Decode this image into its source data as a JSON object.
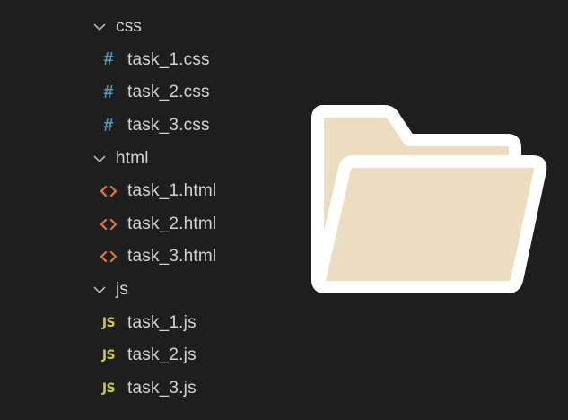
{
  "explorer": {
    "folders": [
      {
        "name": "css",
        "expanded": true,
        "icon": "chevron-down-icon",
        "files": [
          {
            "name": "task_1.css",
            "icon": "css-hash-icon",
            "icon_text": "#"
          },
          {
            "name": "task_2.css",
            "icon": "css-hash-icon",
            "icon_text": "#"
          },
          {
            "name": "task_3.css",
            "icon": "css-hash-icon",
            "icon_text": "#"
          }
        ]
      },
      {
        "name": "html",
        "expanded": true,
        "icon": "chevron-down-icon",
        "files": [
          {
            "name": "task_1.html",
            "icon": "html-code-icon"
          },
          {
            "name": "task_2.html",
            "icon": "html-code-icon"
          },
          {
            "name": "task_3.html",
            "icon": "html-code-icon"
          }
        ]
      },
      {
        "name": "js",
        "expanded": true,
        "icon": "chevron-down-icon",
        "files": [
          {
            "name": "task_1.js",
            "icon": "js-icon",
            "icon_text": "JS"
          },
          {
            "name": "task_2.js",
            "icon": "js-icon",
            "icon_text": "JS"
          },
          {
            "name": "task_3.js",
            "icon": "js-icon",
            "icon_text": "JS"
          }
        ]
      }
    ]
  },
  "illustration": {
    "icon": "open-folder-icon",
    "fill_color": "#ecdcc0",
    "outline_color": "#ffffff"
  },
  "colors": {
    "background": "#1e1e1e",
    "text": "#d4d4d4",
    "css_icon": "#519aba",
    "html_icon": "#e37933",
    "js_icon": "#cbcb41"
  }
}
